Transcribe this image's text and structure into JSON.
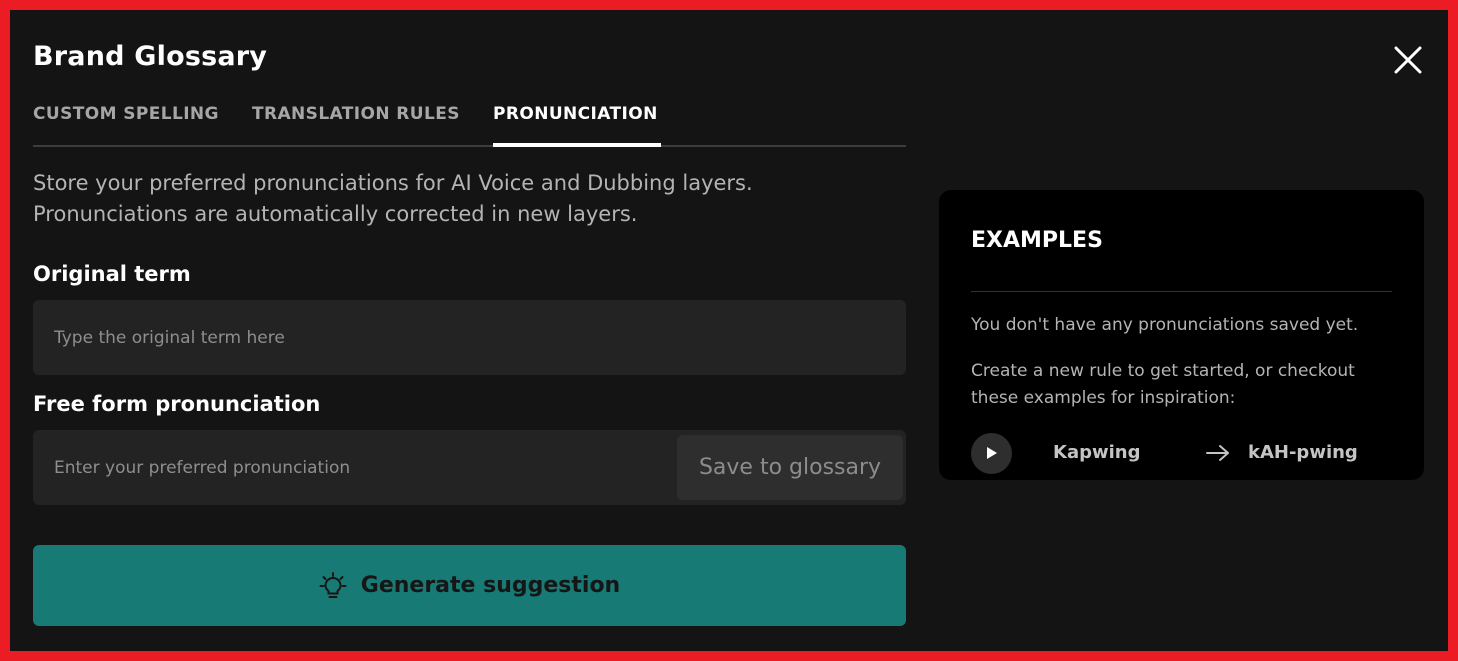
{
  "dialog": {
    "title": "Brand Glossary"
  },
  "tabs": [
    {
      "label": "CUSTOM SPELLING",
      "active": false
    },
    {
      "label": "TRANSLATION RULES",
      "active": false
    },
    {
      "label": "PRONUNCIATION",
      "active": true
    }
  ],
  "description": {
    "line1": "Store your preferred pronunciations for AI Voice and Dubbing layers.",
    "line2": "Pronunciations are automatically corrected in new layers."
  },
  "original_term": {
    "label": "Original term",
    "value": "",
    "placeholder": "Type the original term here"
  },
  "pronunciation": {
    "label": "Free form pronunciation",
    "value": "",
    "placeholder": "Enter your preferred pronunciation",
    "save_label": "Save to glossary"
  },
  "generate": {
    "label": "Generate suggestion",
    "icon": "lightbulb-icon"
  },
  "examples": {
    "title": "EXAMPLES",
    "empty_text": "You don't have any pronunciations saved yet.",
    "hint_text": "Create a new rule to get started, or checkout these examples for inspiration:",
    "items": [
      {
        "term": "Kapwing",
        "pronunciation": "kAH-pwing"
      }
    ]
  },
  "icons": {
    "close": "close-icon",
    "play": "play-icon",
    "arrow": "arrow-right-icon"
  },
  "colors": {
    "accent": "#187a74",
    "background": "#141414",
    "panel": "#000000",
    "input": "#232323",
    "frame_border": "#ec1c24"
  }
}
